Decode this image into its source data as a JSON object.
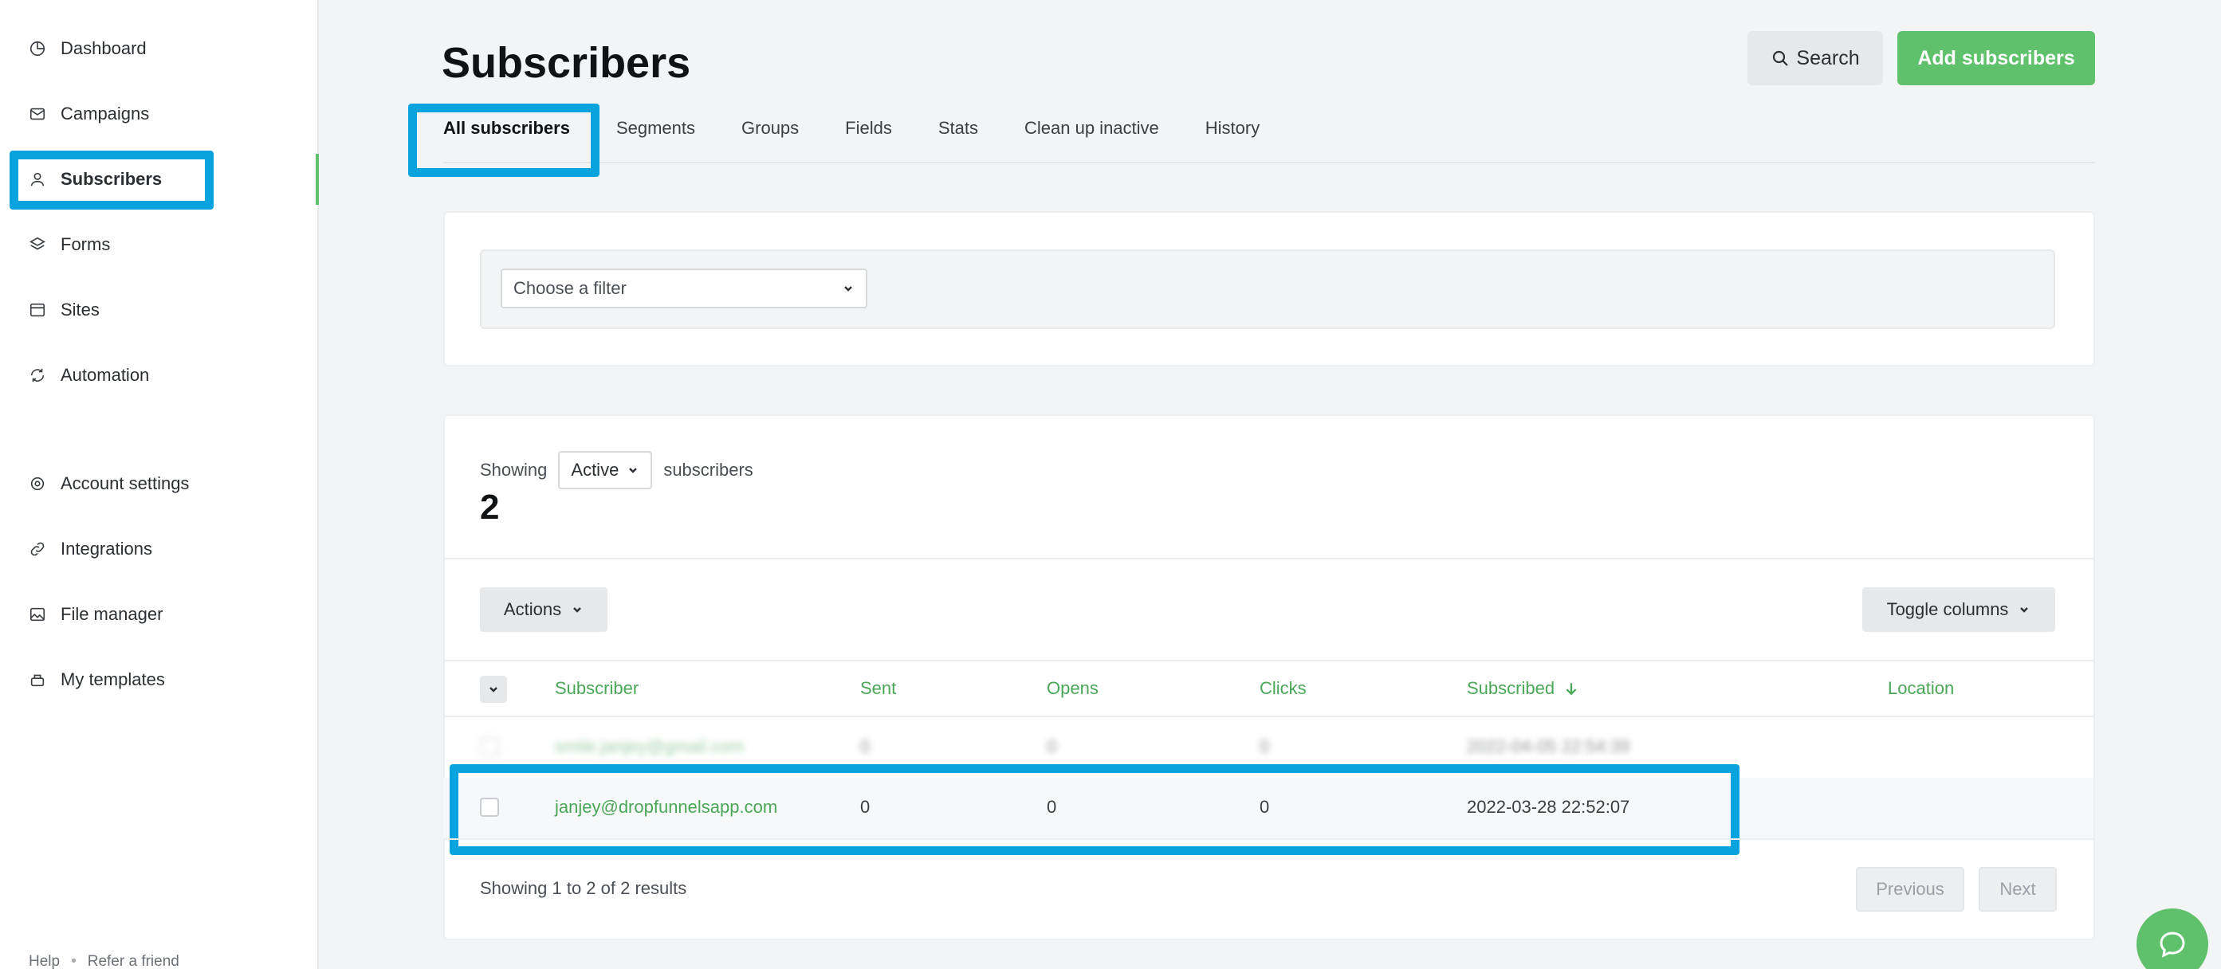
{
  "sidebar": {
    "items": [
      {
        "label": "Dashboard",
        "icon": "dashboard-icon"
      },
      {
        "label": "Campaigns",
        "icon": "mail-icon"
      },
      {
        "label": "Subscribers",
        "icon": "user-icon"
      },
      {
        "label": "Forms",
        "icon": "layers-icon"
      },
      {
        "label": "Sites",
        "icon": "browser-icon"
      },
      {
        "label": "Automation",
        "icon": "refresh-icon"
      },
      {
        "label": "Account settings",
        "icon": "gear-icon"
      },
      {
        "label": "Integrations",
        "icon": "link-icon"
      },
      {
        "label": "File manager",
        "icon": "image-icon"
      },
      {
        "label": "My templates",
        "icon": "template-icon"
      }
    ],
    "footer": {
      "help": "Help",
      "refer": "Refer a friend"
    }
  },
  "header": {
    "title": "Subscribers",
    "search_label": "Search",
    "add_label": "Add subscribers"
  },
  "tabs": [
    "All subscribers",
    "Segments",
    "Groups",
    "Fields",
    "Stats",
    "Clean up inactive",
    "History"
  ],
  "filter": {
    "placeholder": "Choose a filter"
  },
  "list": {
    "showing_label": "Showing",
    "status": "Active",
    "suffix": "subscribers",
    "count": "2",
    "actions_label": "Actions",
    "toggle_label": "Toggle columns",
    "columns": [
      "Subscriber",
      "Sent",
      "Opens",
      "Clicks",
      "Subscribed",
      "Location"
    ],
    "rows": [
      {
        "email": "smile.janjey@gmail.com",
        "sent": "0",
        "opens": "0",
        "clicks": "0",
        "subscribed": "2022-04-05 22:54:39",
        "location": ""
      },
      {
        "email": "janjey@dropfunnelsapp.com",
        "sent": "0",
        "opens": "0",
        "clicks": "0",
        "subscribed": "2022-03-28 22:52:07",
        "location": ""
      }
    ],
    "results": "Showing 1 to 2 of 2 results",
    "prev_label": "Previous",
    "next_label": "Next"
  },
  "colors": {
    "accent": "#5fc16c",
    "highlight": "#09a4e0"
  }
}
